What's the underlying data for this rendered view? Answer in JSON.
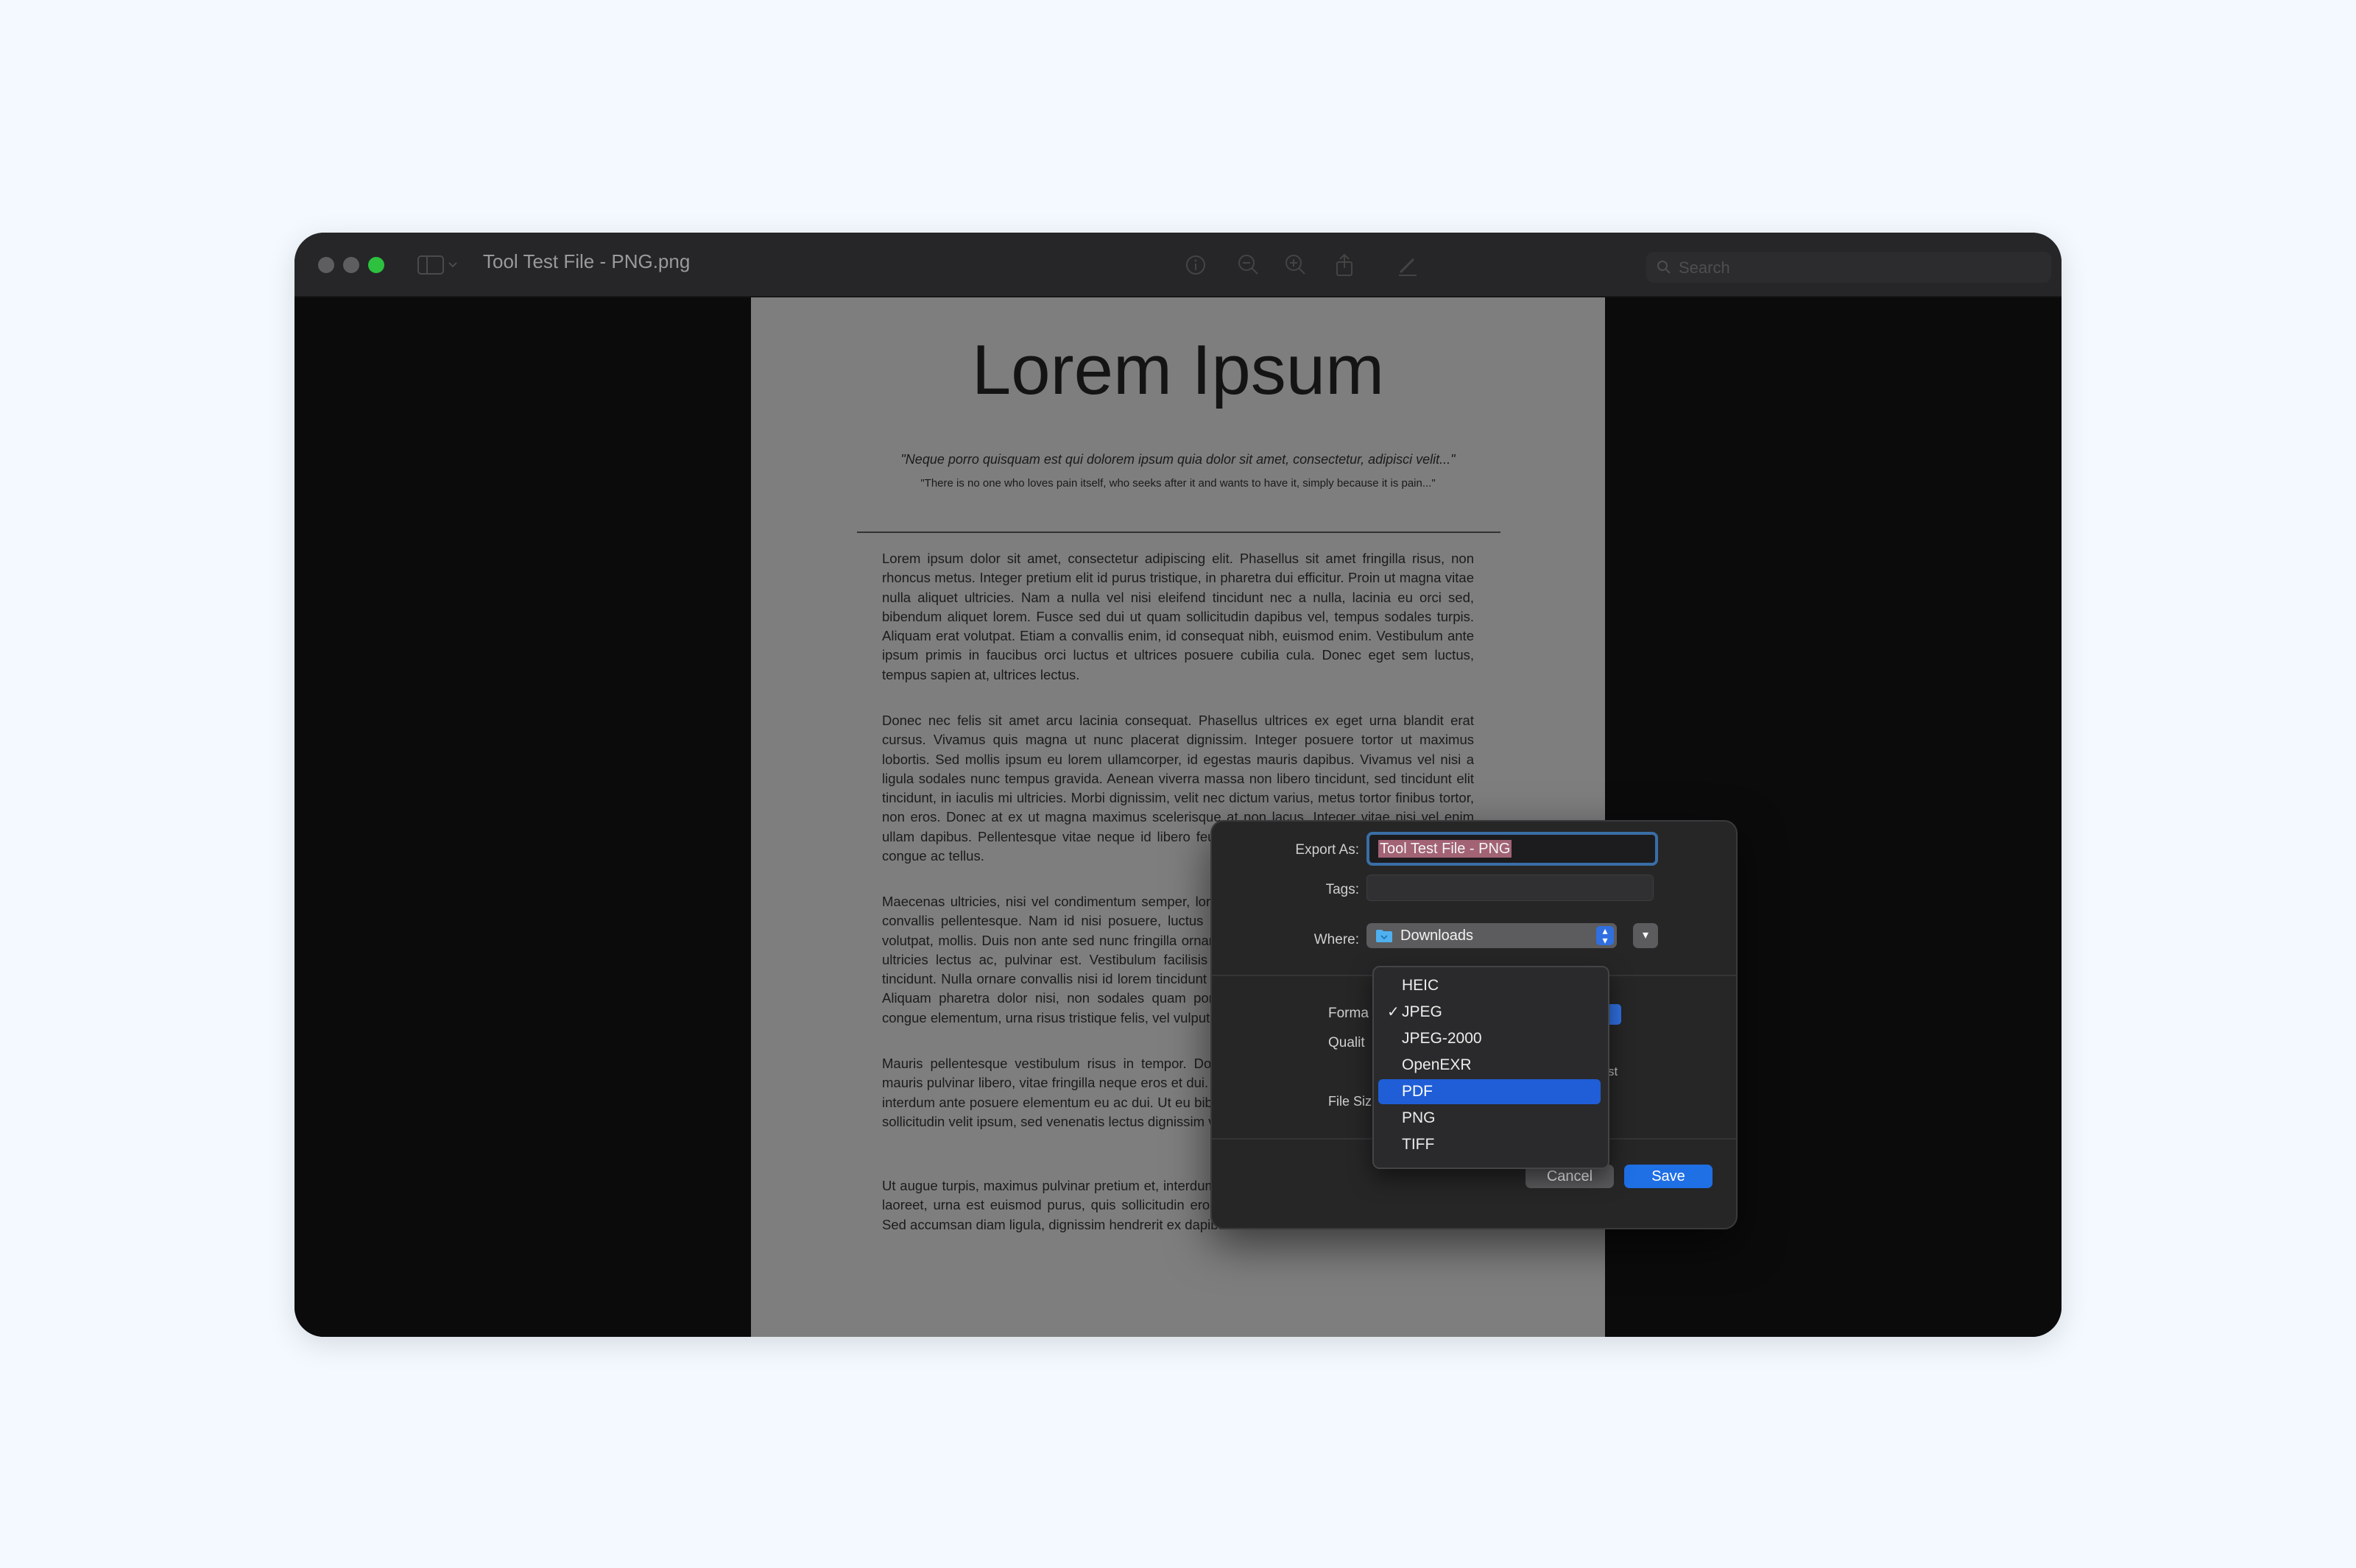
{
  "window": {
    "title": "Tool Test File - PNG.png",
    "search_placeholder": "Search"
  },
  "document": {
    "title": "Lorem Ipsum",
    "quote": "\"Neque porro quisquam est qui dolorem ipsum quia dolor sit amet, consectetur, adipisci velit...\"",
    "quote_translation": "\"There is no one who loves pain itself, who seeks after it and wants to have it, simply because it is pain...\"",
    "paragraphs": [
      "Lorem ipsum dolor sit amet, consectetur adipiscing elit. Phasellus sit amet fringilla risus, non rhoncus metus. Integer pretium elit id purus tristique, in pharetra dui efficitur. Proin ut magna vitae nulla aliquet ultricies. Nam a nulla vel nisi eleifend tincidunt nec a nulla, lacinia eu orci sed, bibendum aliquet lorem. Fusce sed dui ut quam sollicitudin dapibus vel, tempus sodales turpis. Aliquam erat volutpat. Etiam a convallis enim, id consequat nibh, euismod enim. Vestibulum ante ipsum primis in faucibus orci luctus et ultrices posuere cubilia cula. Donec eget sem luctus, tempus sapien at, ultrices lectus.",
      "Donec nec felis sit amet arcu lacinia consequat. Phasellus ultrices ex eget urna blandit erat cursus. Vivamus quis magna ut nunc placerat dignissim. Integer posuere tortor ut maximus lobortis. Sed mollis ipsum eu lorem ullamcorper, id egestas mauris dapibus. Vivamus vel nisi a ligula sodales nunc tempus gravida. Aenean viverra massa non libero tincidunt, sed tincidunt elit tincidunt, in iaculis mi ultricies. Morbi dignissim, velit nec dictum varius, metus tortor finibus tortor, non eros. Donec at ex ut magna maximus scelerisque at non lacus. Integer vitae nisi vel enim ullam dapibus. Pellentesque vitae neque id libero feugiat viverra vitae et nunc. Sed vitae justo congue ac tellus.",
      "Maecenas ultricies, nisi vel condimentum semper, lorem mi sagittis justo, id bibendum elit diam convallis pellentesque. Nam id nisi posuere, luctus quam sed, malesuada nulla. Aliquam erat volutpat, mollis. Duis non ante sed nunc fringilla ornare. Etiam bibendum leo at tellus gravida, ut ultricies lectus ac, pulvinar est. Vestibulum facilisis tortor non urna vehicula, id vehicula elit tincidunt. Nulla ornare convallis nisi id lorem tincidunt ornare. Etiam fermentum pharetra pulvinar. Aliquam pharetra dolor nisi, non sodales quam porta at. Suspendisse sollicitudin, lorem vel congue elementum, urna risus tristique felis, vel vulputate quam libero porttitor turpis.",
      "Mauris pellentesque vestibulum risus in tempor. Donec mollis, ligula in pulvinar auctor, urna mauris pulvinar libero, vitae fringilla neque eros et dui. Morbi nec pretium elit. Integer sit amet nibh interdum ante posuere elementum eu ac dui. Ut eu bibendum ligula, ac lobortis felis. Suspendisse sollicitudin velit ipsum, sed venenatis lectus dignissim vitae. Curabitur eu blandit lorem.",
      "Ut augue turpis, maximus pulvinar pretium et, interdum at est. Vestibulum cursus, elit vitae auctor laoreet, urna est euismod purus, quis sollicitudin eros justo id augue. Sed ut fermentum ligula. Sed accumsan diam ligula, dignissim hendrerit ex dapibus nec. Cras non"
    ]
  },
  "dialog": {
    "export_as_label": "Export As:",
    "export_as_value": "Tool Test File - PNG",
    "tags_label": "Tags:",
    "where_label": "Where:",
    "where_value": "Downloads",
    "format_label_partial": "Forma",
    "quality_label_partial": "Qualit",
    "file_size_label_partial": "File Siz",
    "quality_right_partial": "st",
    "cancel_label": "Cancel",
    "save_label": "Save"
  },
  "format_menu": {
    "items": [
      {
        "label": "HEIC",
        "checked": false,
        "highlighted": false
      },
      {
        "label": "JPEG",
        "checked": true,
        "highlighted": false
      },
      {
        "label": "JPEG-2000",
        "checked": false,
        "highlighted": false
      },
      {
        "label": "OpenEXR",
        "checked": false,
        "highlighted": false
      },
      {
        "label": "PDF",
        "checked": false,
        "highlighted": true
      },
      {
        "label": "PNG",
        "checked": false,
        "highlighted": false
      },
      {
        "label": "TIFF",
        "checked": false,
        "highlighted": false
      }
    ],
    "checkmark": "✓"
  },
  "colors": {
    "accent": "#1f6fe5",
    "menu_highlight": "#1f5ed6",
    "selection": "#a26375",
    "zoom_button": "#2dc13f"
  }
}
